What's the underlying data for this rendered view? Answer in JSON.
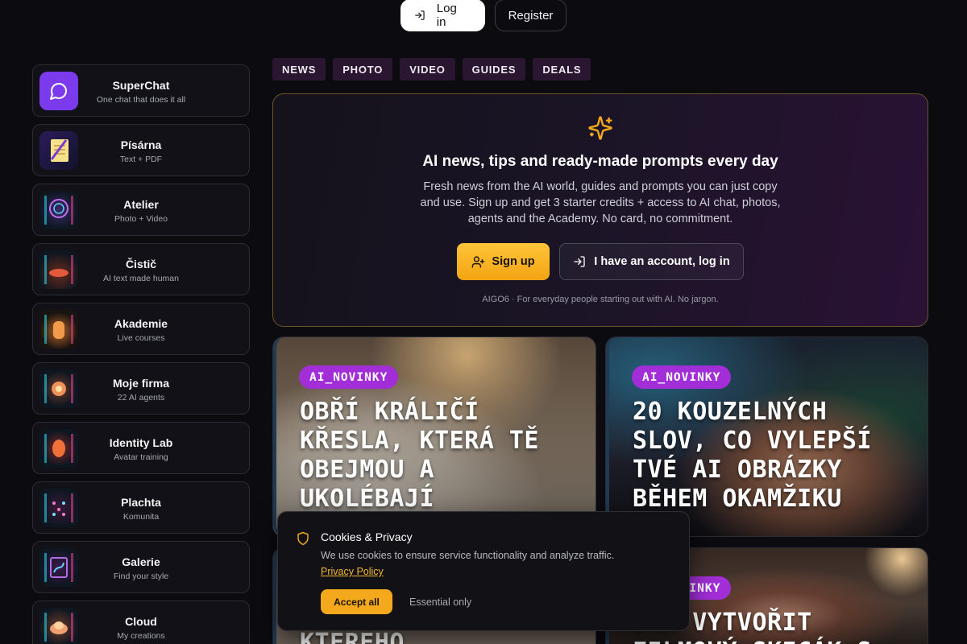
{
  "auth": {
    "login_label": "Log in",
    "register_label": "Register"
  },
  "sidebar": {
    "items": [
      {
        "title": "SuperChat",
        "subtitle": "One chat that does it all",
        "icon": "chat-bubble-icon"
      },
      {
        "title": "Písárna",
        "subtitle": "Text + PDF",
        "icon": "notepad-icon"
      },
      {
        "title": "Atelier",
        "subtitle": "Photo + Video",
        "icon": "atelier-icon"
      },
      {
        "title": "Čistič",
        "subtitle": "AI text made human",
        "icon": "cleaner-icon"
      },
      {
        "title": "Akademie",
        "subtitle": "Live courses",
        "icon": "academy-icon"
      },
      {
        "title": "Moje firma",
        "subtitle": "22 AI agents",
        "icon": "company-icon"
      },
      {
        "title": "Identity Lab",
        "subtitle": "Avatar training",
        "icon": "identity-icon"
      },
      {
        "title": "Plachta",
        "subtitle": "Komunita",
        "icon": "community-icon"
      },
      {
        "title": "Galerie",
        "subtitle": "Find your style",
        "icon": "gallery-icon"
      },
      {
        "title": "Cloud",
        "subtitle": "My creations",
        "icon": "cloud-icon"
      }
    ]
  },
  "tabs": [
    "NEWS",
    "PHOTO",
    "VIDEO",
    "GUIDES",
    "DEALS"
  ],
  "hero": {
    "title": "AI news, tips and ready-made prompts every day",
    "description": "Fresh news from the AI world, guides and prompts you can just copy and use. Sign up and get 3 starter credits + access to AI chat, photos, agents and the Academy. No card, no commitment.",
    "signup_label": "Sign up",
    "have_account_label": "I have an account, log in",
    "footnote": "AIGO6 · For everyday people starting out with AI. No jargon."
  },
  "articles": [
    {
      "badge": "AI_NOVINKY",
      "headline": "OBŘÍ KRÁLIČÍ KŘESLA, KTERÁ TĚ OBEJMOU A UKOLÉBAJÍ"
    },
    {
      "badge": "AI_NOVINKY",
      "headline": "20 KOUZELNÝCH SLOV, CO VYLEPŠÍ TVÉ AI OBRÁZKY BĚHEM OKAMŽIKU"
    },
    {
      "badge": "",
      "headline": "KTERÉHO"
    },
    {
      "badge": "AI_NOVINKY",
      "headline": "JAK VYTVOŘIT FILMOVÝ SKICÁK S"
    }
  ],
  "cookie": {
    "title": "Cookies & Privacy",
    "text": "We use cookies to ensure service functionality and analyze traffic.",
    "link": "Privacy Policy",
    "accept_label": "Accept all",
    "essential_label": "Essential only"
  },
  "colors": {
    "accent_gold": "#f4a81c",
    "tab_bg": "#2a1630",
    "badge_purple": "#a12ed6",
    "superchat_purple": "#7c3aed"
  }
}
